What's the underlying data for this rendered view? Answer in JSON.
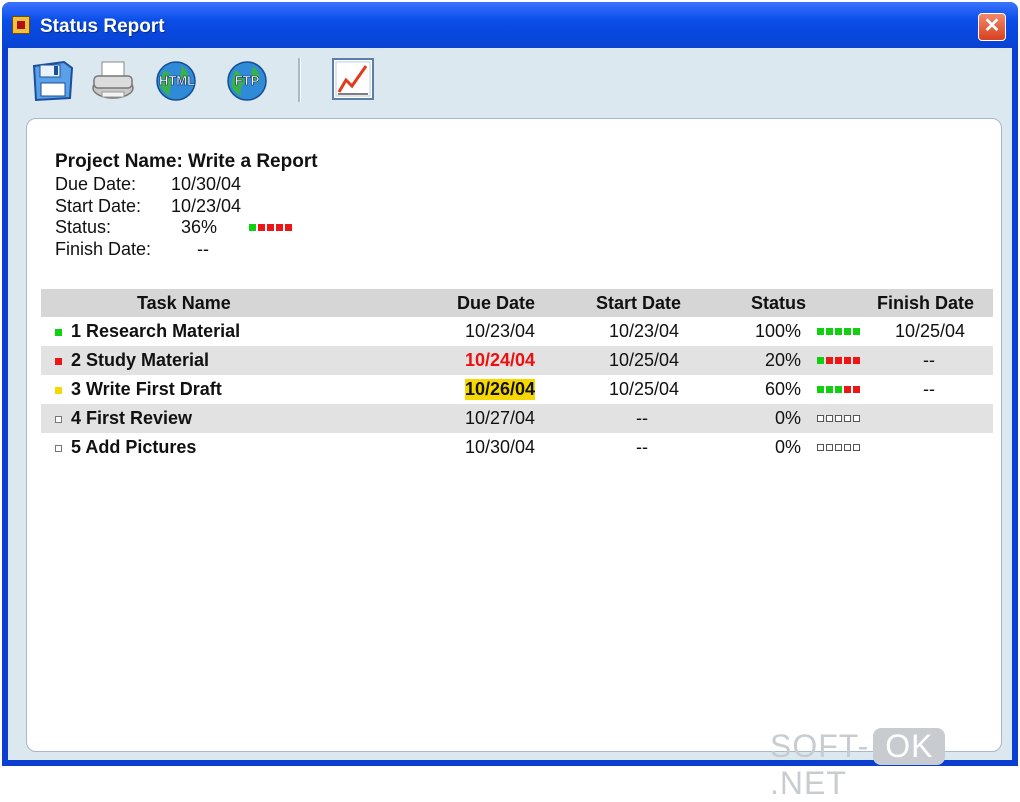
{
  "window": {
    "title": "Status Report",
    "close_label": "✕"
  },
  "toolbar": {
    "buttons": [
      {
        "name": "save-button",
        "icon": "floppy-disk-icon"
      },
      {
        "name": "print-button",
        "icon": "printer-icon"
      },
      {
        "name": "html-export-button",
        "icon": "globe-icon",
        "label": "HTML"
      },
      {
        "name": "ftp-button",
        "icon": "globe-icon",
        "label": "FTP"
      },
      {
        "name": "chart-button",
        "icon": "line-chart-icon"
      }
    ]
  },
  "project": {
    "name_line": "Project Name: Write a Report",
    "due_label": "Due Date:",
    "due_value": "10/30/04",
    "start_label": "Start Date:",
    "start_value": "10/23/04",
    "status_label": "Status:",
    "status_value": "36%",
    "status_bar": [
      "g",
      "r",
      "r",
      "r",
      "r"
    ],
    "finish_label": "Finish Date:",
    "finish_value": "--"
  },
  "table": {
    "headers": {
      "task_name": "Task Name",
      "due_date": "Due Date",
      "start_date": "Start Date",
      "status": "Status",
      "finish_date": "Finish Date"
    },
    "rows": [
      {
        "bullet": "green",
        "name": "1 Research Material",
        "due": "10/23/04",
        "due_style": "",
        "start": "10/23/04",
        "status": "100%",
        "bar": [
          "g",
          "g",
          "g",
          "g",
          "g"
        ],
        "finish": "10/25/04"
      },
      {
        "bullet": "red",
        "name": "2 Study Material",
        "due": "10/24/04",
        "due_style": "red",
        "start": "10/25/04",
        "status": "20%",
        "bar": [
          "g",
          "r",
          "r",
          "r",
          "r"
        ],
        "finish": "--"
      },
      {
        "bullet": "yellow",
        "name": "3 Write First Draft",
        "due": "10/26/04",
        "due_style": "yellow",
        "start": "10/25/04",
        "status": "60%",
        "bar": [
          "g",
          "g",
          "g",
          "r",
          "r"
        ],
        "finish": "--"
      },
      {
        "bullet": "white",
        "name": "4 First Review",
        "due": "10/27/04",
        "due_style": "",
        "start": "--",
        "status": "0%",
        "bar": [
          "e",
          "e",
          "e",
          "e",
          "e"
        ],
        "finish": ""
      },
      {
        "bullet": "white",
        "name": "5 Add Pictures",
        "due": "10/30/04",
        "due_style": "",
        "start": "--",
        "status": "0%",
        "bar": [
          "e",
          "e",
          "e",
          "e",
          "e"
        ],
        "finish": ""
      }
    ]
  },
  "colors": {
    "green": "#10d010",
    "red": "#ee1515",
    "yellow": "#f6d800",
    "titlebar": "#0a4de8"
  },
  "watermark": {
    "left": "SOFT-",
    "middle": "OK",
    "right": ".NET"
  }
}
